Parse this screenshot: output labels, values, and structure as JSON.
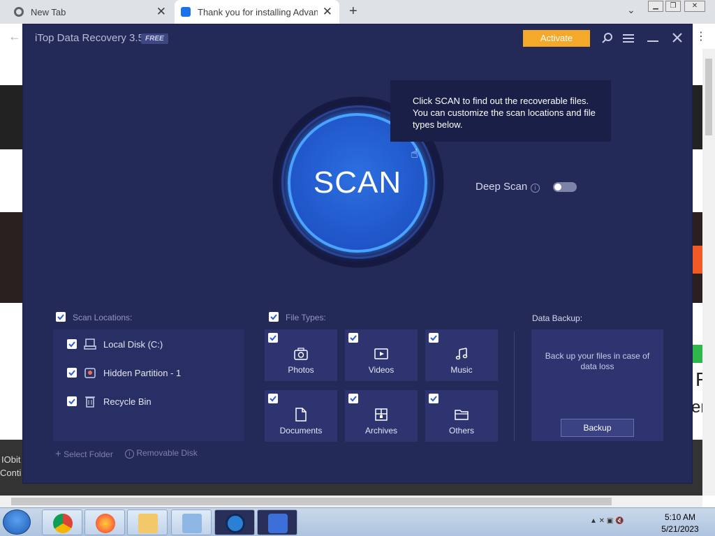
{
  "browser": {
    "tabs": [
      {
        "label": "New Tab"
      },
      {
        "label": "Thank you for installing Advance"
      }
    ],
    "bg_text1": "IObit",
    "bg_text2": "Conti",
    "bg_text3": "F",
    "bg_text4": "er"
  },
  "app": {
    "title": "iTop Data Recovery 3.5",
    "badge": "FREE",
    "activate_label": "Activate",
    "scan_label": "SCAN",
    "tooltip": "Click SCAN to find out the recoverable files. You can customize the scan locations and file types below.",
    "deep_scan_label": "Deep Scan",
    "deep_scan_enabled": false,
    "scan_locations": {
      "header": "Scan Locations:",
      "items": [
        {
          "label": "Local Disk (C:)",
          "icon": "hard-drive-icon",
          "checked": true
        },
        {
          "label": "Hidden Partition - 1",
          "icon": "partition-icon",
          "checked": true
        },
        {
          "label": "Recycle Bin",
          "icon": "recycle-bin-icon",
          "checked": true
        }
      ],
      "select_folder": "Select Folder",
      "removable_disk": "Removable Disk"
    },
    "file_types": {
      "header": "File Types:",
      "items": [
        {
          "label": "Photos",
          "icon": "camera-icon",
          "checked": true
        },
        {
          "label": "Videos",
          "icon": "video-icon",
          "checked": true
        },
        {
          "label": "Music",
          "icon": "music-icon",
          "checked": true
        },
        {
          "label": "Documents",
          "icon": "document-icon",
          "checked": true
        },
        {
          "label": "Archives",
          "icon": "archive-icon",
          "checked": true
        },
        {
          "label": "Others",
          "icon": "folder-icon",
          "checked": true
        }
      ]
    },
    "data_backup": {
      "header": "Data Backup:",
      "text": "Back up your files in case of data loss",
      "button": "Backup"
    }
  },
  "taskbar": {
    "time": "5:10 AM",
    "date": "5/21/2023"
  },
  "colors": {
    "app_bg": "#242a57",
    "accent": "#f4a92a",
    "scan_blue": "#2d6fe0"
  }
}
